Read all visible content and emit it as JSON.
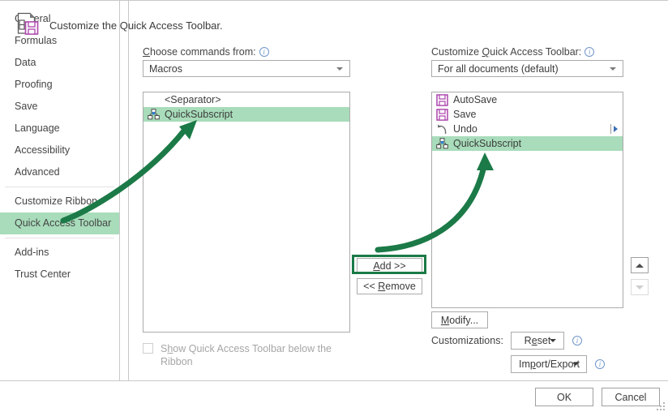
{
  "sidebar": {
    "items": [
      {
        "label": "General",
        "selected": false,
        "divider_after": false
      },
      {
        "label": "Formulas",
        "selected": false,
        "divider_after": false
      },
      {
        "label": "Data",
        "selected": false,
        "divider_after": false
      },
      {
        "label": "Proofing",
        "selected": false,
        "divider_after": false
      },
      {
        "label": "Save",
        "selected": false,
        "divider_after": false
      },
      {
        "label": "Language",
        "selected": false,
        "divider_after": false
      },
      {
        "label": "Accessibility",
        "selected": false,
        "divider_after": false
      },
      {
        "label": "Advanced",
        "selected": false,
        "divider_after": true
      },
      {
        "label": "Customize Ribbon",
        "selected": false,
        "divider_after": false
      },
      {
        "label": "Quick Access Toolbar",
        "selected": true,
        "divider_after": true
      },
      {
        "label": "Add-ins",
        "selected": false,
        "divider_after": false
      },
      {
        "label": "Trust Center",
        "selected": false,
        "divider_after": false
      }
    ]
  },
  "header": {
    "title": "Customize the Quick Access Toolbar.",
    "icon": "customize-qat-icon"
  },
  "left_panel": {
    "label": "Choose commands from:",
    "label_accel": "C",
    "info_icon": "info-icon",
    "combo_value": "Macros",
    "combo_caret": "chevron-down-icon",
    "items": [
      {
        "label": "<Separator>",
        "icon": "separator-icon",
        "selected": false
      },
      {
        "label": "QuickSubscript",
        "icon": "macro-icon",
        "selected": true
      }
    ]
  },
  "right_panel": {
    "label": "Customize Quick Access Toolbar:",
    "label_accel": "Q",
    "info_icon": "info-icon",
    "combo_value": "For all documents (default)",
    "combo_caret": "chevron-down-icon",
    "items": [
      {
        "label": "AutoSave",
        "icon": "save-icon",
        "selected": false,
        "has_submenu": false
      },
      {
        "label": "Save",
        "icon": "save-icon",
        "selected": false,
        "has_submenu": false
      },
      {
        "label": "Undo",
        "icon": "undo-icon",
        "selected": false,
        "has_submenu": true
      },
      {
        "label": "QuickSubscript",
        "icon": "macro-icon",
        "selected": true,
        "has_submenu": false
      }
    ]
  },
  "transfer": {
    "add_label": "Add >>",
    "add_accel": "A",
    "remove_label": "<< Remove",
    "remove_accel": "R"
  },
  "reorder": {
    "up_icon": "move-up-icon",
    "up_enabled": true,
    "down_icon": "move-down-icon",
    "down_enabled": false
  },
  "modify": {
    "label": "Modify...",
    "accel": "M"
  },
  "customizations": {
    "label": "Customizations:",
    "reset_label": "Reset",
    "reset_accel": "e",
    "reset_info": "info-icon",
    "import_export_label": "Import/Export",
    "import_export_accel": "p",
    "import_export_info": "info-icon"
  },
  "checkbox": {
    "label_line1": "Show Quick Access Toolbar below the",
    "label_line2": "Ribbon",
    "accel": "h",
    "checked": false
  },
  "footer": {
    "ok_label": "OK",
    "cancel_label": "Cancel"
  },
  "annotations": {
    "arrow1_target": "QuickSubscript in commands list",
    "arrow2_target": "QuickSubscript in toolbar list",
    "highlight_target": "Add >> button",
    "color": "#1b7a47"
  },
  "colors": {
    "selection_green": "#a8dcba",
    "annotation_green": "#1b7a47",
    "accent_purple": "#b04fb0",
    "info_blue": "#7196c8"
  }
}
